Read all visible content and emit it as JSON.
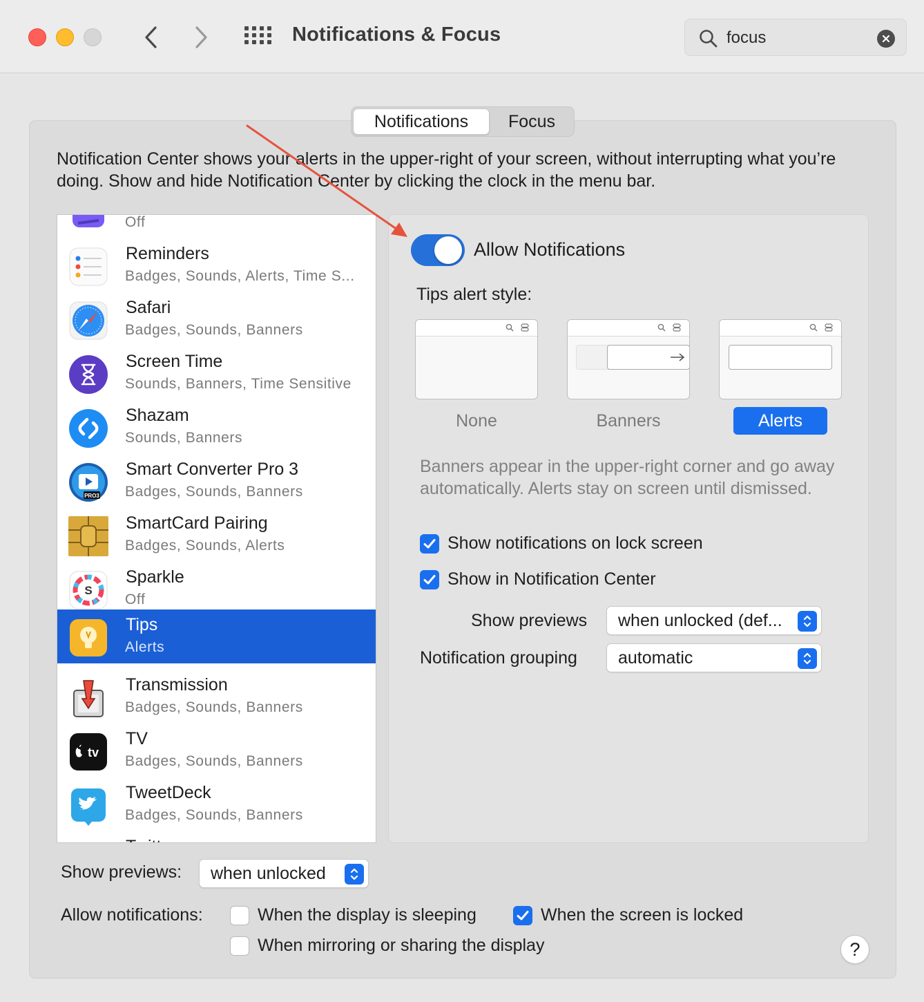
{
  "window": {
    "title": "Notifications & Focus"
  },
  "search": {
    "value": "focus"
  },
  "tabs": [
    "Notifications",
    "Focus"
  ],
  "intro": "Notification Center shows your alerts in the upper-right of your screen, without interrupting what you’re doing. Show and hide Notification Center by clicking the clock in the menu bar.",
  "apps": [
    {
      "name": "",
      "status": "Off",
      "icon": "app-partial-icon"
    },
    {
      "name": "Reminders",
      "status": "Badges, Sounds, Alerts, Time S...",
      "icon": "reminders-icon"
    },
    {
      "name": "Safari",
      "status": "Badges, Sounds, Banners",
      "icon": "safari-icon"
    },
    {
      "name": "Screen Time",
      "status": "Sounds, Banners, Time Sensitive",
      "icon": "screen-time-icon"
    },
    {
      "name": "Shazam",
      "status": "Sounds, Banners",
      "icon": "shazam-icon"
    },
    {
      "name": "Smart Converter Pro 3",
      "status": "Badges, Sounds, Banners",
      "icon": "smart-converter-icon"
    },
    {
      "name": "SmartCard Pairing",
      "status": "Badges, Sounds, Alerts",
      "icon": "smartcard-icon"
    },
    {
      "name": "Sparkle",
      "status": "Off",
      "icon": "sparkle-icon"
    },
    {
      "name": "Tips",
      "status": "Alerts",
      "icon": "tips-icon",
      "selected": true
    },
    {
      "name": "Transmission",
      "status": "Badges, Sounds, Banners",
      "icon": "transmission-icon"
    },
    {
      "name": "TV",
      "status": "Badges, Sounds, Banners",
      "icon": "tv-icon"
    },
    {
      "name": "TweetDeck",
      "status": "Badges, Sounds, Banners",
      "icon": "tweetdeck-icon"
    },
    {
      "name": "Twitter",
      "status": "",
      "icon": "twitter-icon"
    }
  ],
  "detail": {
    "allow_label": "Allow Notifications",
    "allow_on": true,
    "style_label": "Tips alert style:",
    "styles": [
      "None",
      "Banners",
      "Alerts"
    ],
    "selected_style": "Alerts",
    "explain": "Banners appear in the upper-right corner and go away automatically. Alerts stay on screen until dismissed.",
    "lock_screen_label": "Show notifications on lock screen",
    "lock_screen_checked": true,
    "center_label": "Show in Notification Center",
    "center_checked": true,
    "previews_label": "Show previews",
    "previews_value": "when unlocked (def...",
    "grouping_label": "Notification grouping",
    "grouping_value": "automatic"
  },
  "bottom": {
    "previews_label": "Show previews:",
    "previews_value": "when unlocked",
    "allow_label": "Allow notifications:",
    "sleeping_label": "When the display is sleeping",
    "sleeping_checked": false,
    "locked_label": "When the screen is locked",
    "locked_checked": true,
    "mirroring_label": "When mirroring or sharing the display",
    "mirroring_checked": false,
    "help": "?"
  },
  "colors": {
    "accent": "#1a6fee",
    "selection": "#1a5fd6",
    "annotation_arrow": "#e5533d"
  }
}
